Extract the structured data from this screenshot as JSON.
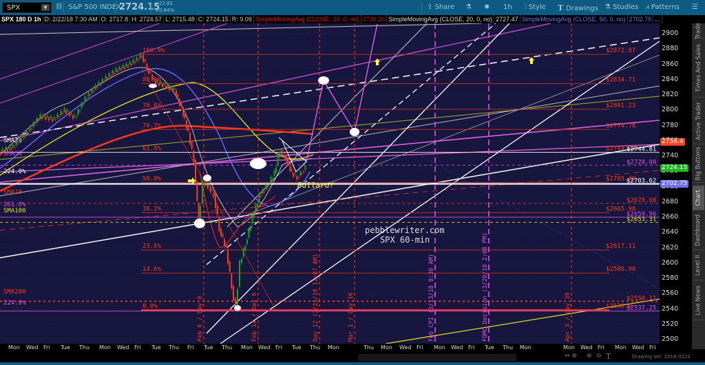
{
  "toolbar": {
    "symbol": "SPX",
    "description": "S&P 500 INDEX",
    "last": "2724.15",
    "change": "+22.82",
    "change_pct": "+0.84%",
    "share": "Share",
    "timeframe": "1h",
    "style": "Style",
    "drawings": "Drawings",
    "studies": "Studies",
    "patterns": "Patterns"
  },
  "infobar": {
    "title": "SPX 180 D 1h",
    "date": "D: 2/22/18 7:30 AM",
    "open": "O: 2717.8",
    "high": "H: 2724.57",
    "low": "L: 2715.48",
    "close": "C: 2724.15",
    "range": "R: 9.09",
    "sma10_label": "SimpleMovingAvg (CLOSE, 10, 0, no)",
    "sma10_value": "2725.26",
    "sma20_label": "SimpleMovingAvg (CLOSE, 20, 0, no)",
    "sma20_value": "2727.47",
    "sma50_label": "SimpleMovingAvg (CLOSE, 50, 0, no)",
    "sma50_value": "2702.75",
    "more": "..."
  },
  "axis": {
    "ticks": [
      "2900",
      "2880",
      "2860",
      "2840",
      "2820",
      "2800",
      "2780",
      "2760",
      "2740",
      "2720",
      "2700",
      "2680",
      "2660",
      "2640",
      "2620",
      "2600",
      "2580",
      "2560",
      "2540",
      "2520",
      "2500"
    ],
    "badges": [
      {
        "value": "2758.4",
        "color": "#ff4422"
      },
      {
        "value": "2724.15",
        "color": "#1fb51f"
      },
      {
        "value": "2702.75",
        "color": "#7070ff"
      }
    ]
  },
  "sidebar": {
    "tabs": [
      "Trade",
      "Times And Sales",
      "Active Trader",
      "Big Buttons",
      "Chart",
      "Dashboard",
      "Level II",
      "Live News"
    ],
    "selected": "Chart"
  },
  "time_axis": [
    "Mon",
    "Wed",
    "Fri",
    "Tue",
    "Thu",
    "Mon",
    "Wed",
    "Fri",
    "Tue",
    "Thu",
    "Fri",
    "Tue",
    "Thu",
    "Mon",
    "Wed",
    "Fri",
    "Tue",
    "Thu",
    "Mon",
    "Thu",
    "Mon",
    "Wed",
    "Fri",
    "Mon",
    "Wed",
    "Fri",
    "Tue",
    "Thu",
    "Mon",
    "Mon",
    "Wed",
    "Fri",
    "Mon",
    "Wed",
    "Fri"
  ],
  "footer": {
    "drawing_set": "Drawing set: 2018-0222"
  },
  "chart": {
    "fib_levels": [
      {
        "pct": "100.0%",
        "price": "$2872.87",
        "v": 2872.87
      },
      {
        "pct": "88.6%",
        "price": "$2834.71",
        "v": 2834.71
      },
      {
        "pct": "78.6%",
        "price": "$2801.23",
        "v": 2801.23
      },
      {
        "pct": "70.7%",
        "price": "$2774.78",
        "v": 2774.78
      },
      {
        "pct": "61.8%",
        "price": "$2744.98",
        "v": 2744.98
      },
      {
        "pct": "50.0%",
        "price": "$2705.48",
        "v": 2705.48
      },
      {
        "pct": "38.2%",
        "price": "$2665.98",
        "v": 2665.98
      },
      {
        "pct": "23.6%",
        "price": "$2617.11",
        "v": 2617.11
      },
      {
        "pct": "14.6%",
        "price": "$2586.98",
        "v": 2586.98
      },
      {
        "pct": "0.0%",
        "price": "$2538.6",
        "v": 2538.6
      }
    ],
    "other_levels": [
      {
        "label": "SMA20",
        "price": "$2744.81",
        "v": 2744.81,
        "color": "#ffffff"
      },
      {
        "label": "SMA50",
        "price": "$2728.08",
        "v": 2728.08,
        "color": "#e050e0"
      },
      {
        "label": "224.0%",
        "price": "$2703.62",
        "v": 2703.62,
        "color": "#ffffff"
      },
      {
        "label": "SMA10",
        "price": "$2678.08",
        "v": 2678.08,
        "color": "#ff3a1a"
      },
      {
        "label": "261.8%",
        "price": "$2659.96",
        "v": 2659.96,
        "color": "#e050e0"
      },
      {
        "label": "SMA100",
        "price": "$2653.31",
        "v": 2653.31,
        "color": "#e0e020"
      },
      {
        "label": "SMA200",
        "price": "$2550.11",
        "v": 2550.11,
        "color": "#ff3a1a"
      },
      {
        "label": "224.0%",
        "price": "$2537.25",
        "v": 2537.25,
        "color": "#e050e0"
      }
    ],
    "events": [
      {
        "label": "Feb 6 / Day 0",
        "color": "#ff3a1a"
      },
      {
        "label": "Feb 14 / Day 6",
        "color": "#ff3a1a"
      },
      {
        "label": "Day 12 (2/23/18 11:07 AM)",
        "color": "#ff3a1a"
      },
      {
        "label": "Mar 1 / Day 16",
        "color": "#ff3a1a"
      },
      {
        "label": "Feb CPI (3/13/18 8:30 AM)",
        "color": "#e050e0"
      },
      {
        "label": "FOMC Decision (3/20/18 2:00 PM)",
        "color": "#e050e0"
      },
      {
        "label": "Apr 3 / day 39",
        "color": "#ff3a1a"
      }
    ],
    "watermark1": "pebblewriter.com",
    "watermark2": "SPX 60-min",
    "annotation": "Bullard!",
    "price_path": [
      [
        0,
        2745
      ],
      [
        20,
        2752
      ],
      [
        40,
        2770
      ],
      [
        60,
        2792
      ],
      [
        80,
        2788
      ],
      [
        95,
        2800
      ],
      [
        110,
        2790
      ],
      [
        125,
        2815
      ],
      [
        140,
        2830
      ],
      [
        155,
        2842
      ],
      [
        170,
        2852
      ],
      [
        185,
        2858
      ],
      [
        200,
        2866
      ],
      [
        207,
        2872
      ],
      [
        215,
        2855
      ],
      [
        225,
        2838
      ],
      [
        240,
        2832
      ],
      [
        255,
        2826
      ],
      [
        265,
        2803
      ],
      [
        275,
        2770
      ],
      [
        283,
        2735
      ],
      [
        290,
        2650
      ],
      [
        296,
        2705
      ],
      [
        305,
        2700
      ],
      [
        312,
        2690
      ],
      [
        320,
        2645
      ],
      [
        330,
        2618
      ],
      [
        338,
        2570
      ],
      [
        344,
        2538
      ],
      [
        350,
        2600
      ],
      [
        358,
        2625
      ],
      [
        368,
        2660
      ],
      [
        378,
        2688
      ],
      [
        390,
        2702
      ],
      [
        400,
        2718
      ],
      [
        408,
        2748
      ],
      [
        416,
        2738
      ],
      [
        425,
        2718
      ],
      [
        433,
        2712
      ],
      [
        440,
        2720
      ],
      [
        445,
        2724
      ]
    ]
  }
}
